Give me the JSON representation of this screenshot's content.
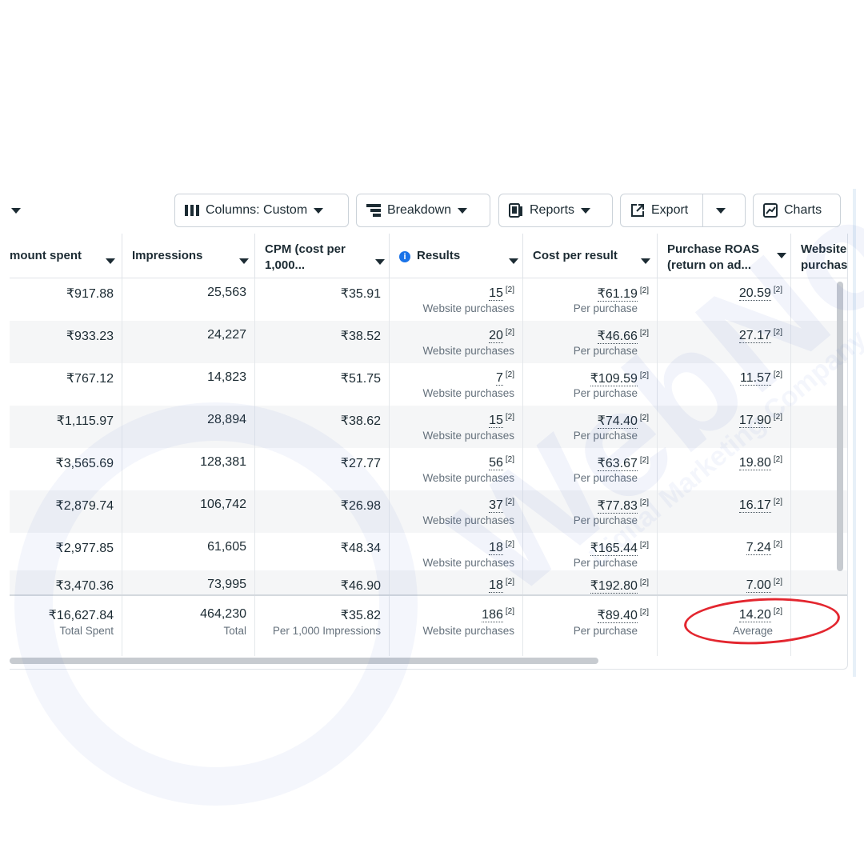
{
  "toolbar": {
    "columns_label": "Columns: Custom",
    "breakdown_label": "Breakdown",
    "reports_label": "Reports",
    "export_label": "Export",
    "charts_label": "Charts"
  },
  "columns": [
    {
      "label": "mount spent"
    },
    {
      "label": "Impressions"
    },
    {
      "label": "CPM (cost per",
      "label2": "1,000..."
    },
    {
      "label": "Results"
    },
    {
      "label": "Cost per result"
    },
    {
      "label": "Purchase ROAS",
      "label2": "(return on ad..."
    },
    {
      "label": "Website",
      "label2": "purchas"
    }
  ],
  "rows": [
    {
      "spent": "₹917.88",
      "impressions": "25,563",
      "cpm": "₹35.91",
      "results": "15",
      "results_sub": "Website purchases",
      "cpr": "₹61.19",
      "cpr_sub": "Per purchase",
      "roas": "20.59"
    },
    {
      "spent": "₹933.23",
      "impressions": "24,227",
      "cpm": "₹38.52",
      "results": "20",
      "results_sub": "Website purchases",
      "cpr": "₹46.66",
      "cpr_sub": "Per purchase",
      "roas": "27.17"
    },
    {
      "spent": "₹767.12",
      "impressions": "14,823",
      "cpm": "₹51.75",
      "results": "7",
      "results_sub": "Website purchases",
      "cpr": "₹109.59",
      "cpr_sub": "Per purchase",
      "roas": "11.57"
    },
    {
      "spent": "₹1,115.97",
      "impressions": "28,894",
      "cpm": "₹38.62",
      "results": "15",
      "results_sub": "Website purchases",
      "cpr": "₹74.40",
      "cpr_sub": "Per purchase",
      "roas": "17.90"
    },
    {
      "spent": "₹3,565.69",
      "impressions": "128,381",
      "cpm": "₹27.77",
      "results": "56",
      "results_sub": "Website purchases",
      "cpr": "₹63.67",
      "cpr_sub": "Per purchase",
      "roas": "19.80"
    },
    {
      "spent": "₹2,879.74",
      "impressions": "106,742",
      "cpm": "₹26.98",
      "results": "37",
      "results_sub": "Website purchases",
      "cpr": "₹77.83",
      "cpr_sub": "Per purchase",
      "roas": "16.17"
    },
    {
      "spent": "₹2,977.85",
      "impressions": "61,605",
      "cpm": "₹48.34",
      "results": "18",
      "results_sub": "Website purchases",
      "cpr": "₹165.44",
      "cpr_sub": "Per purchase",
      "roas": "7.24"
    },
    {
      "spent": "₹3,470.36",
      "impressions": "73,995",
      "cpm": "₹46.90",
      "results": "18",
      "results_sub": "",
      "cpr": "₹192.80",
      "cpr_sub": "",
      "roas": "7.00"
    }
  ],
  "footnote_marker": "[2]",
  "totals": {
    "spent": "₹16,627.84",
    "spent_sub": "Total Spent",
    "impressions": "464,230",
    "impressions_sub": "Total",
    "cpm": "₹35.82",
    "cpm_sub": "Per 1,000 Impressions",
    "results": "186",
    "results_sub": "Website purchases",
    "cpr": "₹89.40",
    "cpr_sub": "Per purchase",
    "roas": "14.20",
    "roas_sub": "Average"
  },
  "watermark": {
    "brand": "WebNoca!",
    "tagline": "Digital Marketing Company"
  },
  "colors": {
    "annotation": "#e3262f",
    "info_icon": "#1a73e8",
    "watermark": "#4b5fc9"
  }
}
